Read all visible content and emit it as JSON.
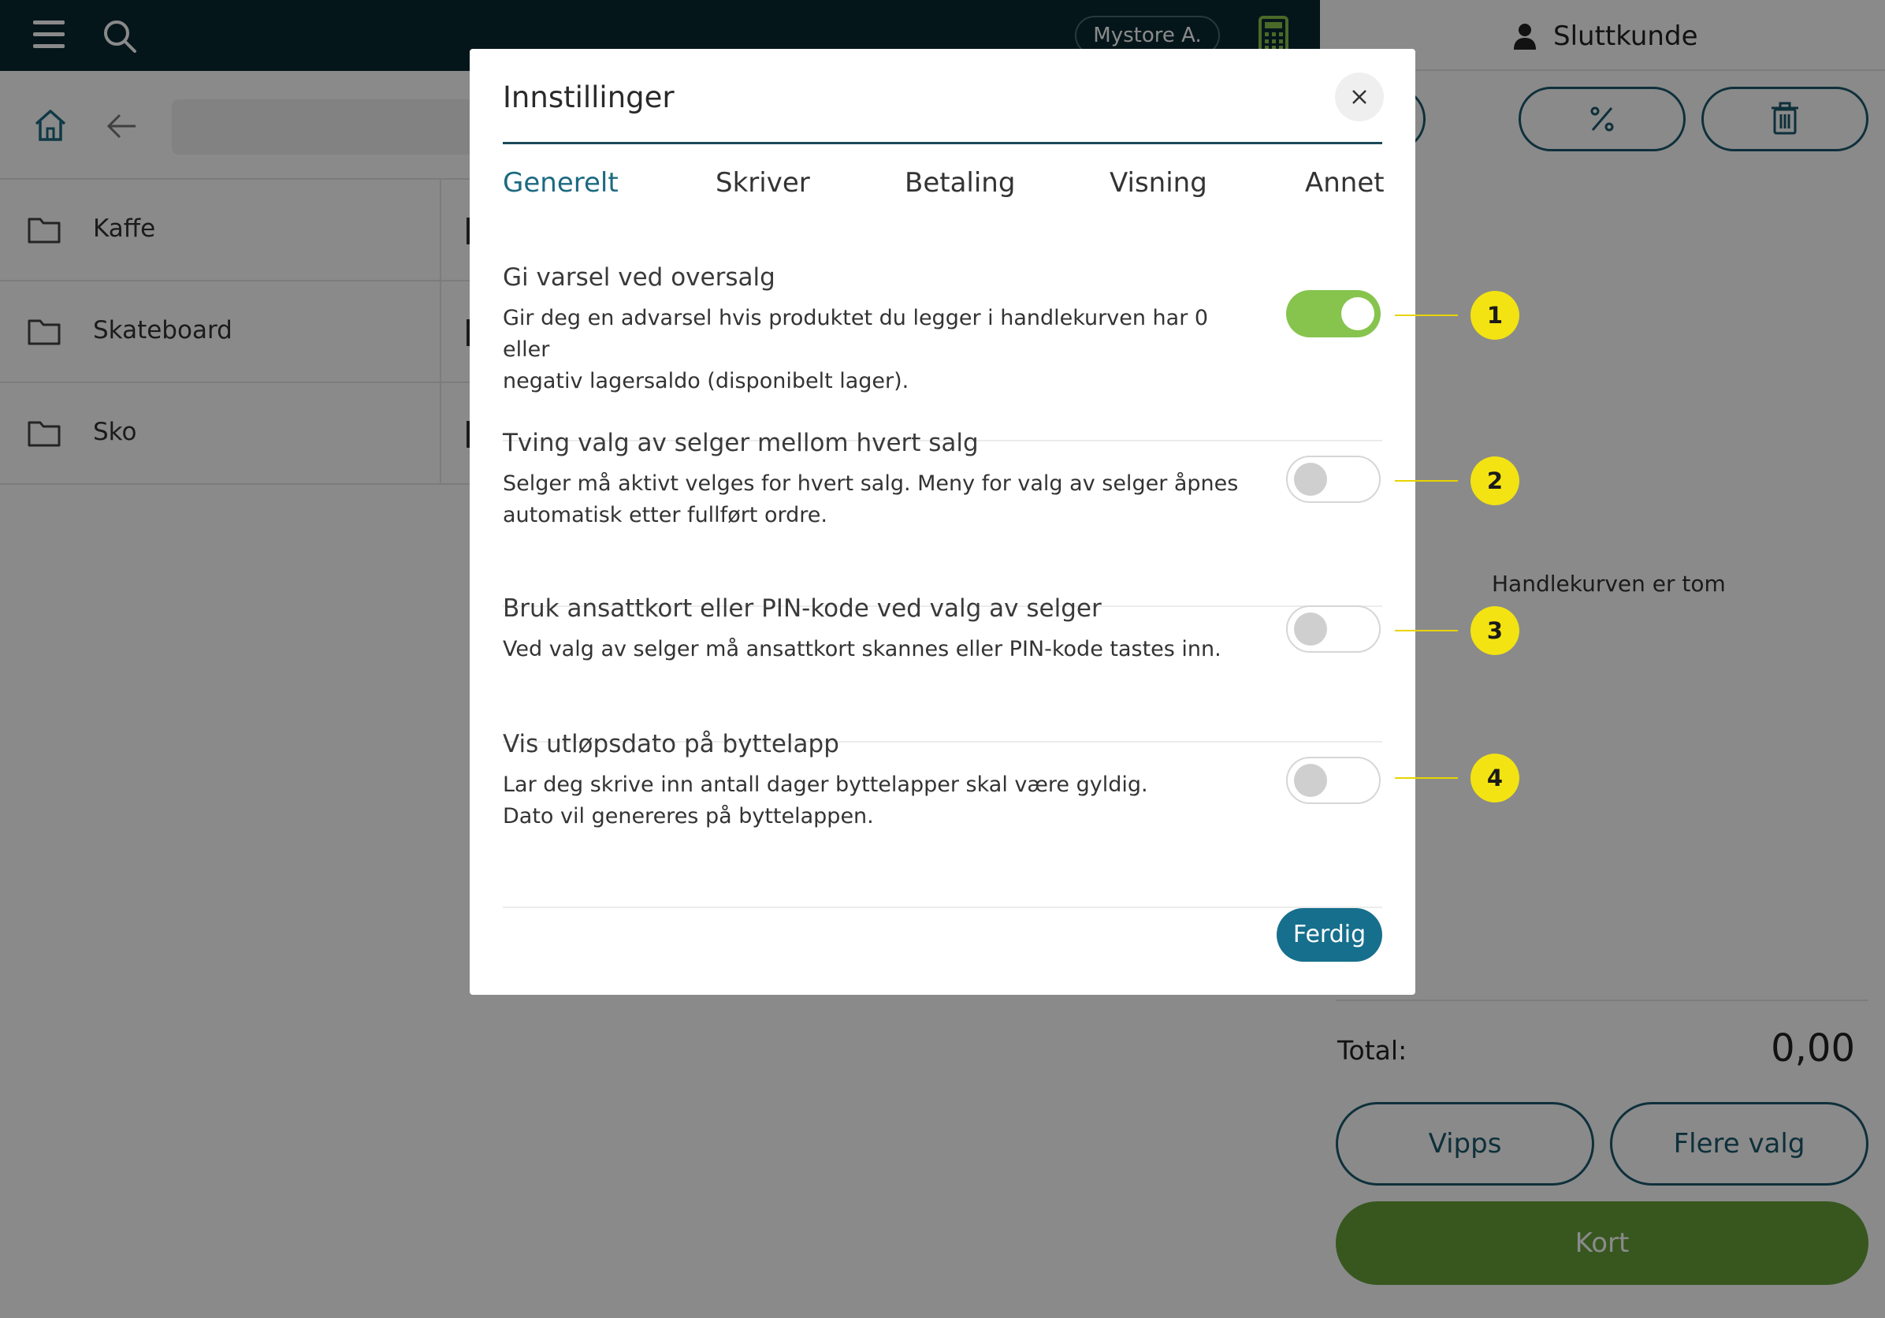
{
  "topbar": {
    "store_name": "Mystore A."
  },
  "categories": [
    {
      "label": "Kaffe"
    },
    {
      "label": "Skateboard"
    },
    {
      "label": "Sko"
    }
  ],
  "cart": {
    "customer": "Sluttkunde",
    "empty_text": "Handlekurven er tom",
    "total_label": "Total:",
    "total_value": "0,00",
    "pay_buttons": {
      "vipps": "Vipps",
      "more": "Flere valg",
      "card": "Kort"
    }
  },
  "modal": {
    "title": "Innstillinger",
    "tabs": [
      "Generelt",
      "Skriver",
      "Betaling",
      "Visning",
      "Annet"
    ],
    "active_tab": "Generelt",
    "settings": [
      {
        "title": "Gi varsel ved oversalg",
        "desc_lines": [
          "Gir deg en advarsel hvis produktet du legger i handlekurven har 0 eller",
          "negativ lagersaldo (disponibelt lager)."
        ],
        "enabled": true
      },
      {
        "title": "Tving valg av selger mellom hvert salg",
        "desc_lines": [
          "Selger må aktivt velges for hvert salg. Meny for valg av selger åpnes",
          "automatisk etter fullført ordre."
        ],
        "enabled": false
      },
      {
        "title": "Bruk ansattkort eller PIN-kode ved valg av selger",
        "desc_lines": [
          "Ved valg av selger må ansattkort skannes eller PIN-kode tastes inn."
        ],
        "enabled": false
      },
      {
        "title": "Vis utløpsdato på byttelapp",
        "desc_lines": [
          "Lar deg skrive inn antall dager byttelapper skal være gyldig.",
          "Dato vil genereres på byttelappen."
        ],
        "enabled": false
      }
    ],
    "done_label": "Ferdig"
  },
  "callouts": [
    "1",
    "2",
    "3",
    "4"
  ],
  "colors": {
    "accent": "#166f8c",
    "toggle_on": "#86c44e",
    "card_button": "#67a23a",
    "callout": "#f3e312",
    "topbar": "#0b2a33"
  }
}
